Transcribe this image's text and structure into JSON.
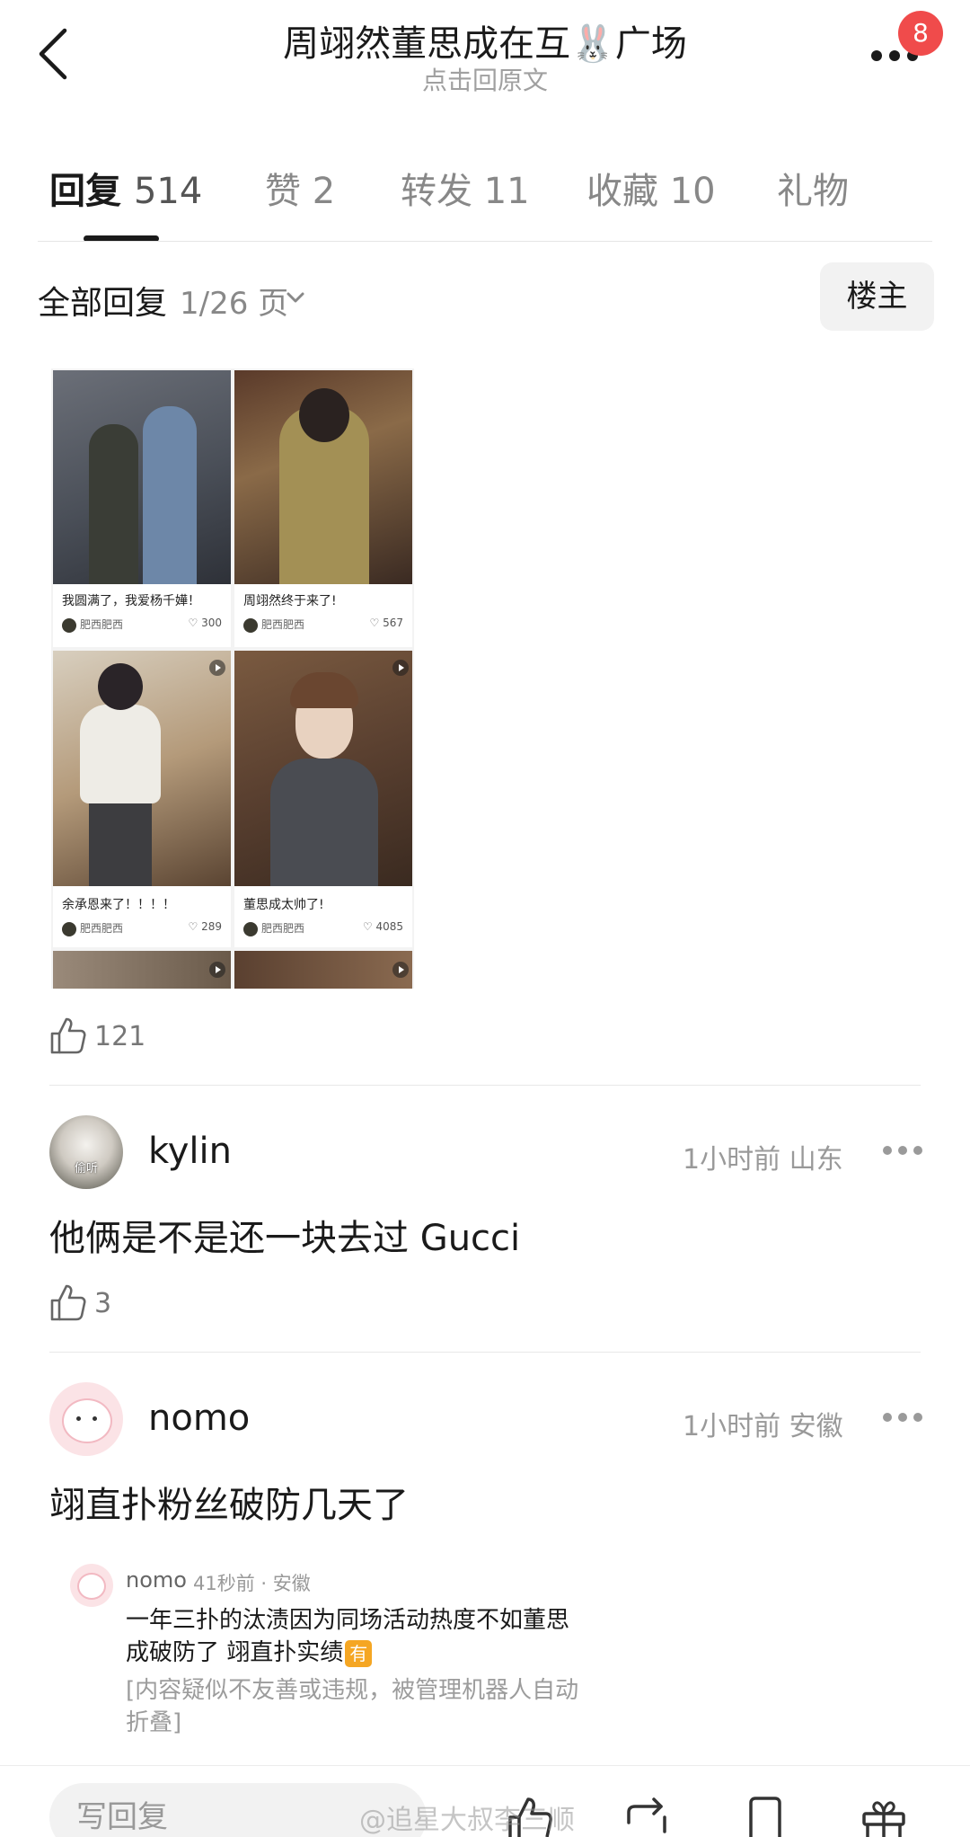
{
  "header": {
    "title": "周翊然董思成在互🐰广场",
    "subtitle": "点击回原文",
    "notification_count": "8"
  },
  "tabs": [
    {
      "label": "回复",
      "count": "514"
    },
    {
      "label": "赞",
      "count": "2"
    },
    {
      "label": "转发",
      "count": "11"
    },
    {
      "label": "收藏",
      "count": "10"
    },
    {
      "label": "礼物",
      "count": ""
    }
  ],
  "filter": {
    "title": "全部回复",
    "page": "1/26 页",
    "owner_button": "楼主"
  },
  "image_cards": [
    {
      "title": "我圆满了，我爱杨千嬅！",
      "author": "肥西肥西",
      "likes": "300",
      "tone": "#5b5f66"
    },
    {
      "title": "周翊然终于来了!",
      "author": "肥西肥西",
      "likes": "567",
      "tone": "#9b8a55"
    },
    {
      "title": "余承恩来了！！！！",
      "author": "肥西肥西",
      "likes": "289",
      "tone": "#c9c0b0"
    },
    {
      "title": "董思成太帅了!",
      "author": "肥西肥西",
      "likes": "4085",
      "tone": "#6b5a48"
    }
  ],
  "post": {
    "likes": "121"
  },
  "comments": [
    {
      "user": "kylin",
      "time": "1小时前",
      "location": "山东",
      "text": "他俩是不是还一块去过 Gucci",
      "likes": "3",
      "avatar_label": "偷听"
    },
    {
      "user": "nomo",
      "time": "1小时前",
      "location": "安徽",
      "text": "翊直扑粉丝破防几天了"
    }
  ],
  "sub_reply": {
    "user": "nomo",
    "meta": "41秒前 · 安徽",
    "line1": "一年三扑的汰渍因为同场活动热度不如董思",
    "line2": "成破防了 翊直扑实绩",
    "tag": "有",
    "folded_line1": "[内容疑似不友善或违规，被管理机器人自动",
    "folded_line2": "折叠]"
  },
  "bottom_bar": {
    "reply_placeholder": "写回复",
    "watermark": "@追星大叔李三顺"
  },
  "colors": {
    "badge": "#f04b4b",
    "tag": "#f5a623"
  }
}
